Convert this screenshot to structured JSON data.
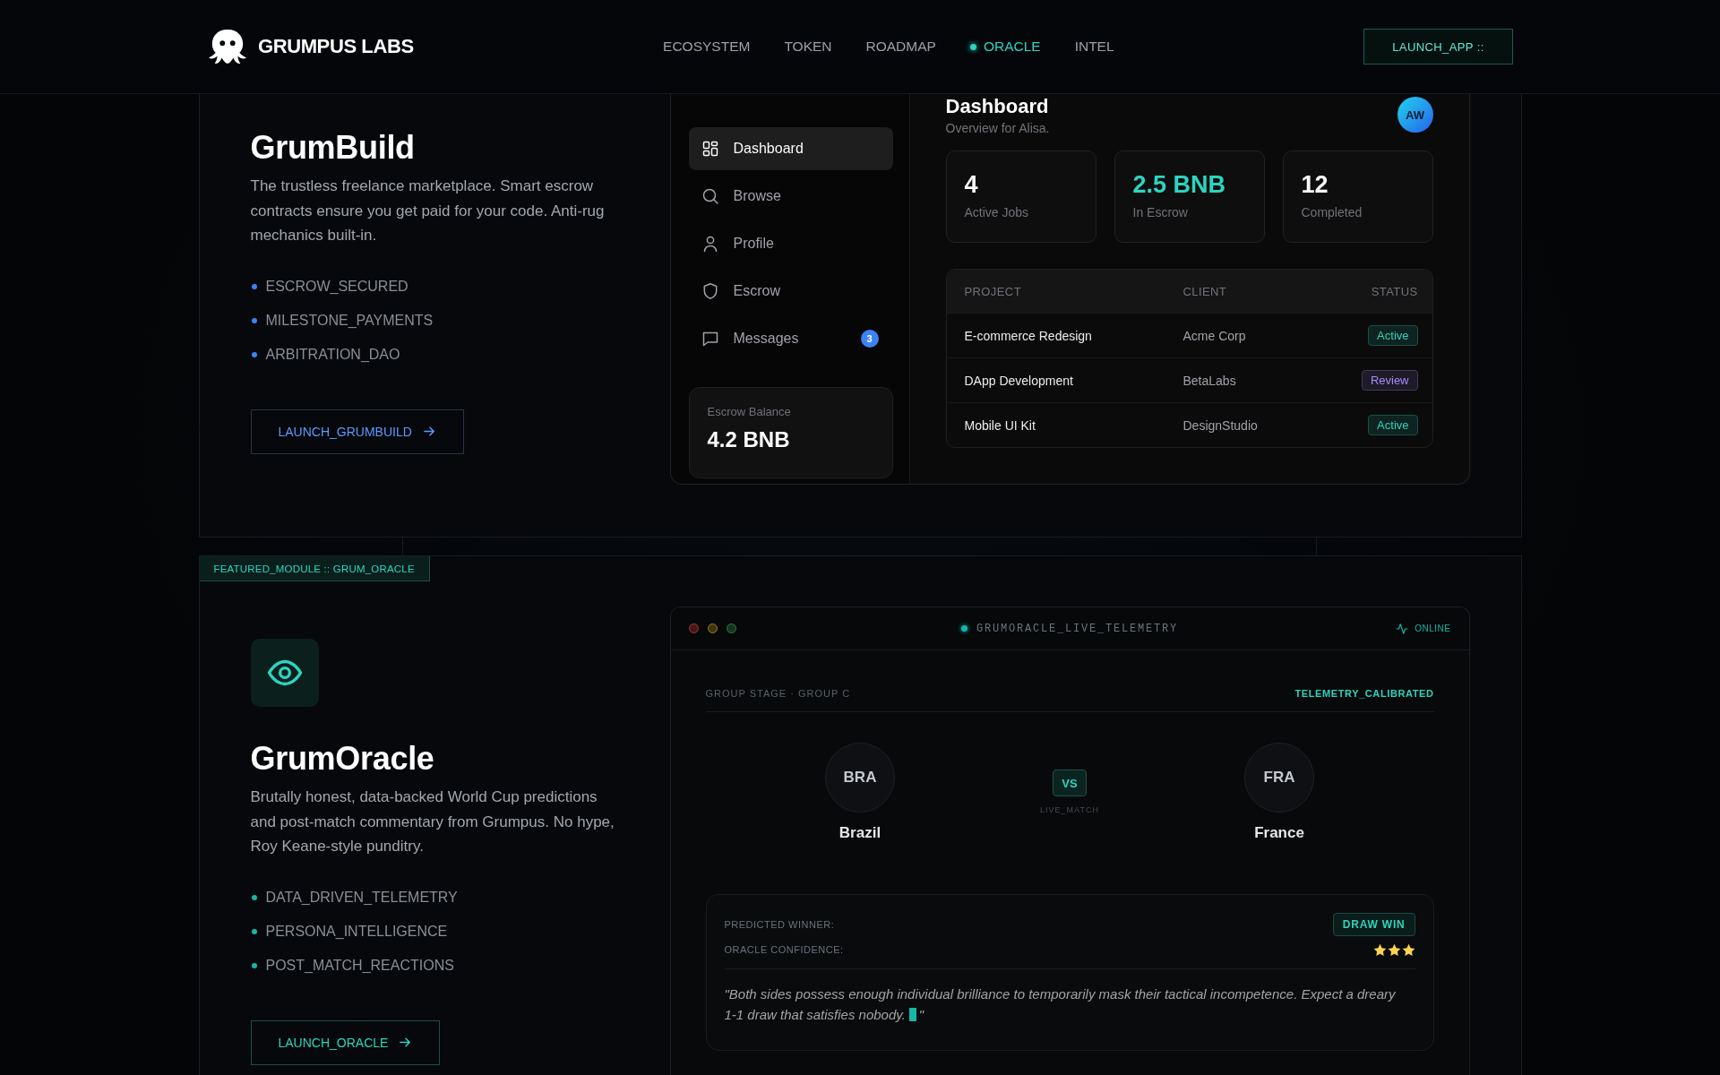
{
  "header": {
    "brand": "GRUMPUS LABS",
    "nav": [
      {
        "label": "ECOSYSTEM",
        "selected": false
      },
      {
        "label": "TOKEN",
        "selected": false
      },
      {
        "label": "ROADMAP",
        "selected": false
      },
      {
        "label": "ORACLE",
        "selected": true
      },
      {
        "label": "INTEL",
        "selected": false
      }
    ],
    "cta": "LAUNCH_APP ::"
  },
  "grumbuild": {
    "title": "GrumBuild",
    "description": "The trustless freelance marketplace. Smart escrow contracts ensure you get paid for your code. Anti-rug mechanics built-in.",
    "features": [
      "ESCROW_SECURED",
      "MILESTONE_PAYMENTS",
      "ARBITRATION_DAO"
    ],
    "button": "LAUNCH_GRUMBUILD",
    "preview": {
      "sidebar": [
        {
          "label": "Dashboard",
          "selected": true
        },
        {
          "label": "Browse",
          "selected": false
        },
        {
          "label": "Profile",
          "selected": false
        },
        {
          "label": "Escrow",
          "selected": false
        },
        {
          "label": "Messages",
          "selected": false,
          "badge": "3"
        }
      ],
      "balance": {
        "label": "Escrow Balance",
        "value": "4.2 BNB"
      },
      "heading": "Dashboard",
      "subheading": "Overview for Alisa.",
      "avatar": "AW",
      "stats": [
        {
          "value": "4",
          "label": "Active Jobs",
          "highlighted": false
        },
        {
          "value": "2.5 BNB",
          "label": "In Escrow",
          "highlighted": true
        },
        {
          "value": "12",
          "label": "Completed",
          "highlighted": false
        }
      ],
      "table": {
        "columns": [
          "PROJECT",
          "CLIENT",
          "STATUS"
        ],
        "rows": [
          {
            "project": "E-commerce Redesign",
            "client": "Acme Corp",
            "status": "Active",
            "color": "#2dd4bf"
          },
          {
            "project": "DApp Development",
            "client": "BetaLabs",
            "status": "Review",
            "color": "#a78bfa"
          },
          {
            "project": "Mobile UI Kit",
            "client": "DesignStudio",
            "status": "Active",
            "color": "#2dd4bf"
          }
        ]
      }
    }
  },
  "oracle": {
    "tag": "FEATURED_MODULE :: GRUM_ORACLE",
    "title": "GrumOracle",
    "description": "Brutally honest, data-backed World Cup predictions and post-match commentary from Grumpus. No hype, Roy Keane-style punditry.",
    "features": [
      "DATA_DRIVEN_TELEMETRY",
      "PERSONA_INTELLIGENCE",
      "POST_MATCH_REACTIONS"
    ],
    "button": "LAUNCH_ORACLE",
    "telemetry": {
      "title": "GRUMORACLE_LIVE_TELEMETRY",
      "live": true,
      "status": "ONLINE",
      "stage": "GROUP STAGE · GROUP C",
      "calibration": "TELEMETRY_CALIBRATED",
      "teams": [
        {
          "code": "BRA",
          "name": "Brazil"
        },
        {
          "code": "FRA",
          "name": "France"
        }
      ],
      "versus": "VS",
      "match_state": "LIVE_MATCH",
      "prediction": {
        "winner_label": "PREDICTED WINNER:",
        "winner": "DRAW WIN",
        "confidence_label": "ORACLE CONFIDENCE:",
        "stars": 3,
        "quote_lines": [
          "\"Both sides possess enough individual brilliance to temporarily mask their tactical incompetence. Expect a dreary",
          "1-1 draw that satisfies nobody."
        ],
        "quote_close": "\""
      }
    }
  }
}
